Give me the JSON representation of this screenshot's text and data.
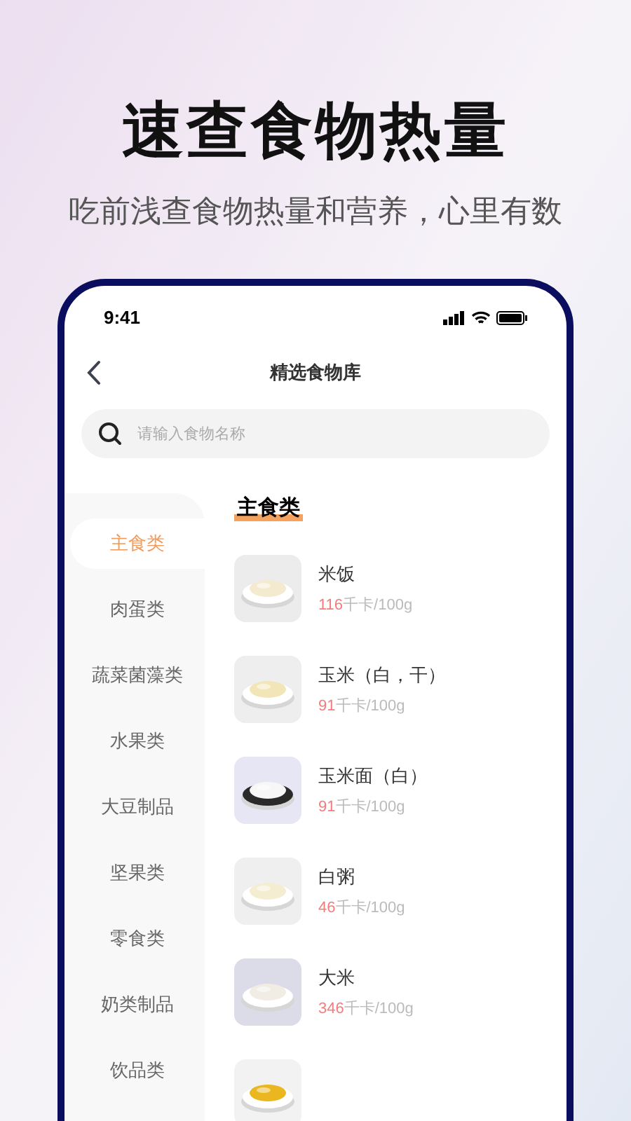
{
  "promo": {
    "title": "速查食物热量",
    "subtitle": "吃前浅查食物热量和营养，心里有数"
  },
  "status_bar": {
    "time": "9:41"
  },
  "nav": {
    "title": "精选食物库"
  },
  "search": {
    "placeholder": "请输入食物名称"
  },
  "categories": [
    {
      "label": "主食类",
      "selected": true
    },
    {
      "label": "肉蛋类",
      "selected": false
    },
    {
      "label": "蔬菜菌藻类",
      "selected": false
    },
    {
      "label": "水果类",
      "selected": false
    },
    {
      "label": "大豆制品",
      "selected": false
    },
    {
      "label": "坚果类",
      "selected": false
    },
    {
      "label": "零食类",
      "selected": false
    },
    {
      "label": "奶类制品",
      "selected": false
    },
    {
      "label": "饮品类",
      "selected": false
    }
  ],
  "section_title": "主食类",
  "foods": [
    {
      "kind": "food",
      "name": "米饭",
      "kcal": "116",
      "unit": "千卡/100g"
    },
    {
      "kind": "food",
      "name": "玉米（白，干）",
      "kcal": "91",
      "unit": "千卡/100g"
    },
    {
      "kind": "food",
      "name": "玉米面（白）",
      "kcal": "91",
      "unit": "千卡/100g"
    },
    {
      "kind": "food",
      "name": "白粥",
      "kcal": "46",
      "unit": "千卡/100g"
    },
    {
      "kind": "food",
      "name": "大米",
      "kcal": "346",
      "unit": "千卡/100g"
    },
    {
      "kind": "picture"
    }
  ]
}
